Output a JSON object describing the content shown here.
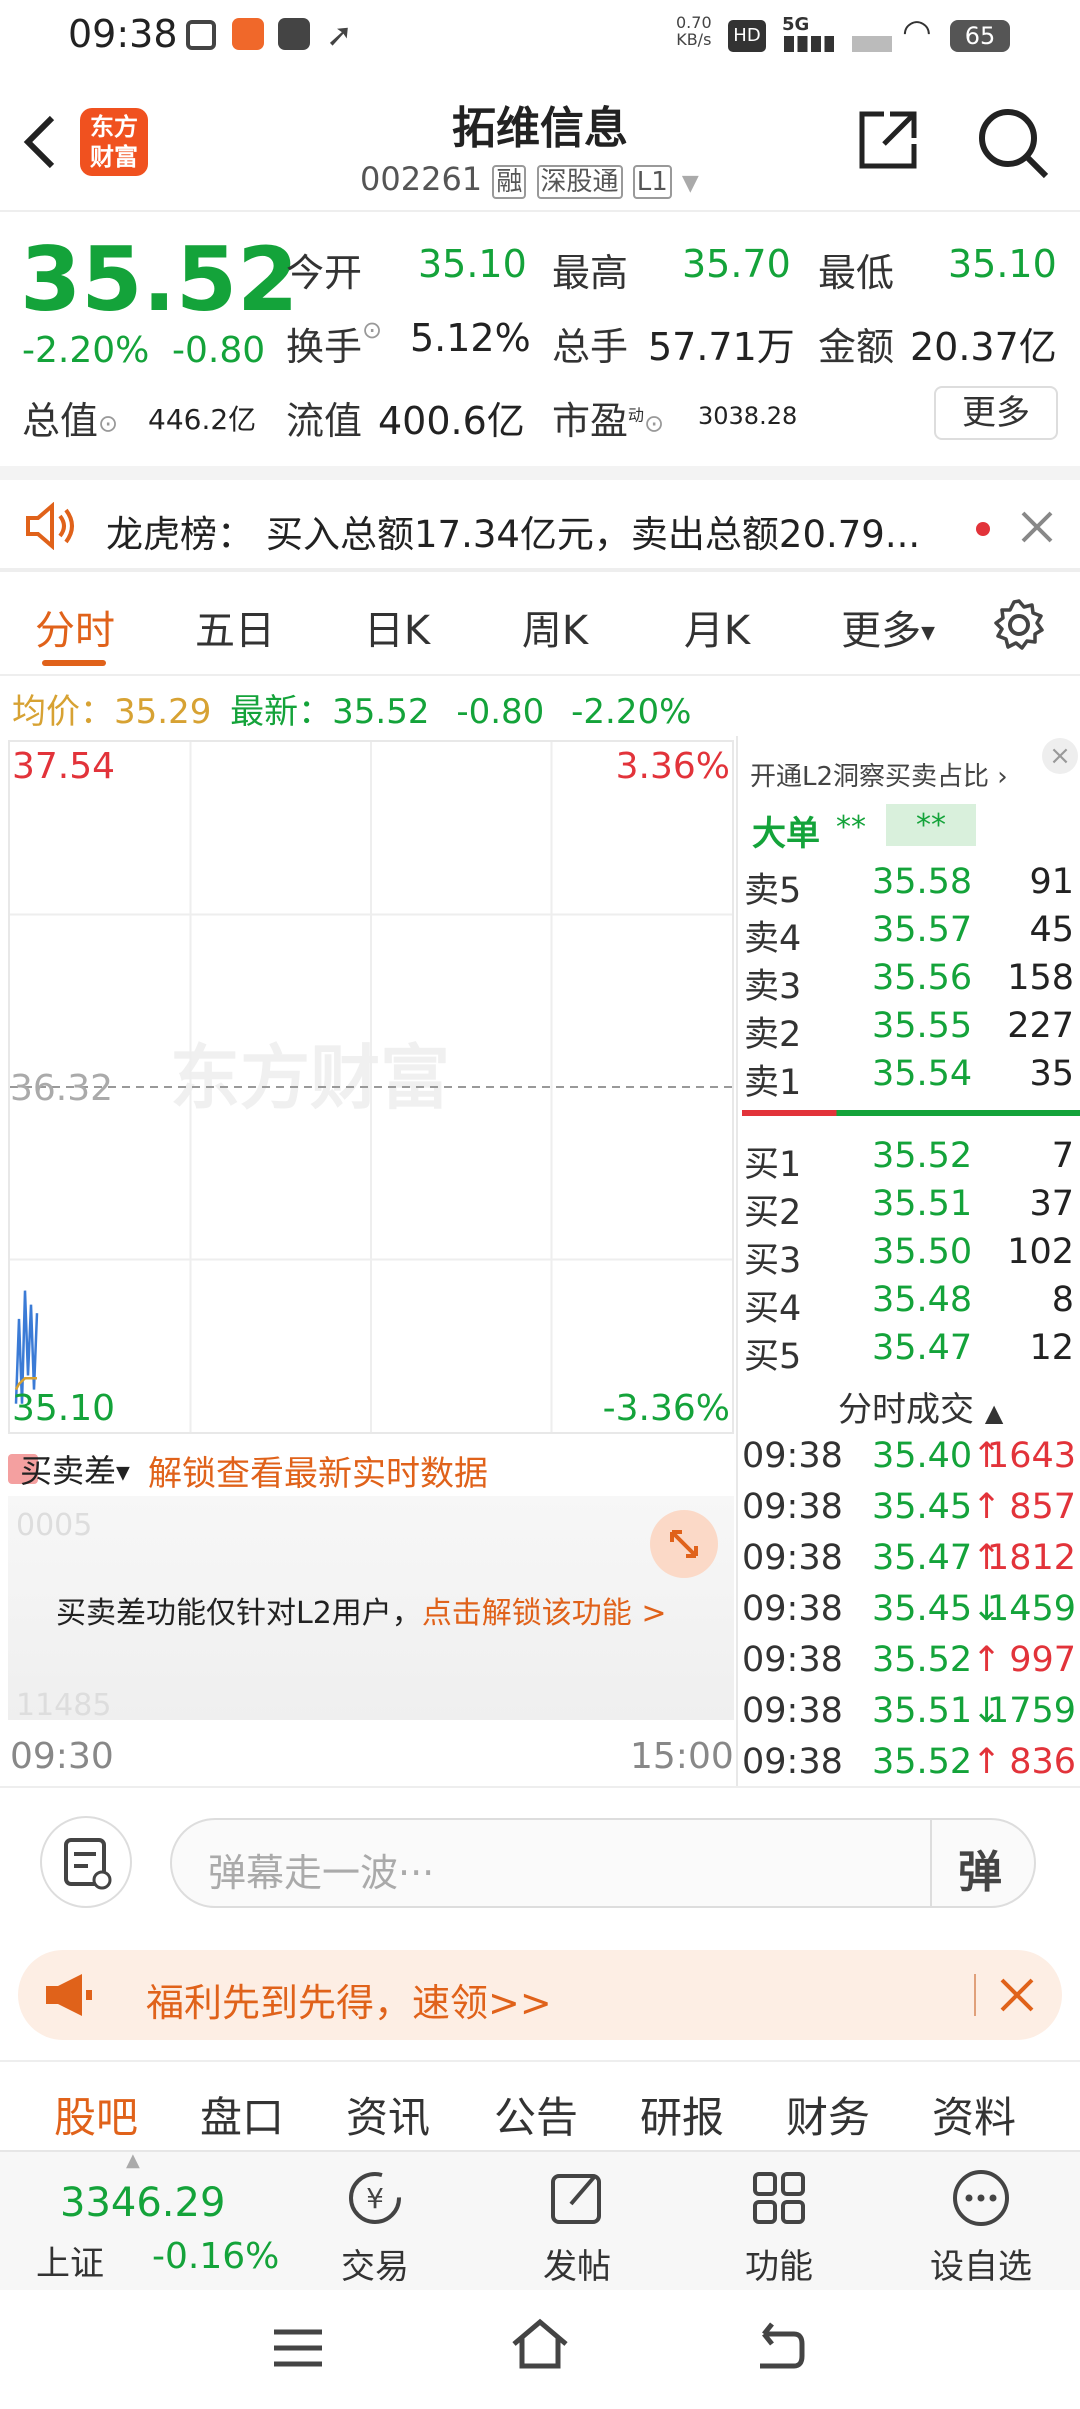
{
  "status_bar": {
    "time": "09:38",
    "net_speed": "0.70",
    "net_unit": "KB/s",
    "network": "5G",
    "battery": "65"
  },
  "header": {
    "logo_text_1": "东方",
    "logo_text_2": "财富",
    "title": "拓维信息",
    "code": "002261",
    "tag_rong": "融",
    "tag_sgt": "深股通",
    "tag_level": "L1"
  },
  "quote": {
    "price": "35.52",
    "change_pct": "-2.20%",
    "change_amt": "-0.80",
    "open_label": "今开",
    "open": "35.10",
    "high_label": "最高",
    "high": "35.70",
    "low_label": "最低",
    "low": "35.10",
    "turnover_label": "换手",
    "turnover": "5.12%",
    "volume_label": "总手",
    "volume": "57.71万",
    "amount_label": "金额",
    "amount": "20.37亿",
    "mktcap_label": "总值",
    "mktcap": "446.2亿",
    "float_label": "流值",
    "float": "400.6亿",
    "pe_label": "市盈",
    "pe_sup": "动",
    "pe": "3038.28",
    "more_button": "更多"
  },
  "notice": {
    "label": "龙虎榜：",
    "text": "买入总额17.34亿元，卖出总额20.79..."
  },
  "chart_tabs": [
    "分时",
    "五日",
    "日K",
    "周K",
    "月K",
    "更多"
  ],
  "avg_line": {
    "avg_label": "均价：",
    "avg": "35.29",
    "latest_label": "最新：",
    "latest": "35.52",
    "change_amt": "-0.80",
    "change_pct": "-2.20%"
  },
  "chart_data": {
    "type": "line",
    "y_top": "37.54",
    "y_mid": "36.32",
    "y_bottom": "35.10",
    "pct_top": "3.36%",
    "pct_bottom": "-3.36%",
    "x_start": "09:30",
    "x_end": "15:00",
    "ylim": [
      35.1,
      37.54
    ],
    "watermark": "东方财富",
    "price_series": [
      35.2,
      35.5,
      35.2,
      35.6,
      35.3,
      35.55,
      35.25,
      35.52
    ],
    "avg_series": [
      35.25,
      35.27,
      35.28,
      35.29,
      35.29,
      35.29,
      35.29,
      35.29
    ]
  },
  "sub_chart": {
    "selector": "买卖差",
    "unlock_link": "解锁查看最新实时数据",
    "y_top": "0005",
    "y_bottom": "11485",
    "lock_text": "买卖差功能仅针对L2用户，",
    "lock_link": "点击解锁该功能 >"
  },
  "order_book": {
    "promo": "开通L2洞察买卖占比",
    "big_order_label": "大单",
    "big_order_val1": "**",
    "big_order_val2": "**",
    "asks": [
      {
        "label": "卖5",
        "price": "35.58",
        "vol": "91"
      },
      {
        "label": "卖4",
        "price": "35.57",
        "vol": "45"
      },
      {
        "label": "卖3",
        "price": "35.56",
        "vol": "158"
      },
      {
        "label": "卖2",
        "price": "35.55",
        "vol": "227"
      },
      {
        "label": "卖1",
        "price": "35.54",
        "vol": "35"
      }
    ],
    "bids": [
      {
        "label": "买1",
        "price": "35.52",
        "vol": "7"
      },
      {
        "label": "买2",
        "price": "35.51",
        "vol": "37"
      },
      {
        "label": "买3",
        "price": "35.50",
        "vol": "102"
      },
      {
        "label": "买4",
        "price": "35.48",
        "vol": "8"
      },
      {
        "label": "买5",
        "price": "35.47",
        "vol": "12"
      }
    ],
    "ticks_header": "分时成交",
    "ticks": [
      {
        "time": "09:38",
        "price": "35.40",
        "dir": "↑",
        "vol": "1643",
        "color": "#e2333a"
      },
      {
        "time": "09:38",
        "price": "35.45",
        "dir": "↑",
        "vol": "857",
        "color": "#e2333a"
      },
      {
        "time": "09:38",
        "price": "35.47",
        "dir": "↑",
        "vol": "1812",
        "color": "#e2333a"
      },
      {
        "time": "09:38",
        "price": "35.45",
        "dir": "↓",
        "vol": "1459",
        "color": "#14a33a"
      },
      {
        "time": "09:38",
        "price": "35.52",
        "dir": "↑",
        "vol": "997",
        "color": "#e2333a"
      },
      {
        "time": "09:38",
        "price": "35.51",
        "dir": "↓",
        "vol": "1759",
        "color": "#14a33a"
      },
      {
        "time": "09:38",
        "price": "35.52",
        "dir": "↑",
        "vol": "836",
        "color": "#e2333a"
      }
    ]
  },
  "comment": {
    "placeholder": "弹幕走一波···",
    "danmu_button": "弹"
  },
  "banner": {
    "text": "福利先到先得，速领>>"
  },
  "bottom_tabs": [
    "股吧",
    "盘口",
    "资讯",
    "公告",
    "研报",
    "财务",
    "资料"
  ],
  "bottom_nav": {
    "index_value": "3346.29",
    "index_name": "上证",
    "index_change": "-0.16%",
    "trade": "交易",
    "post": "发帖",
    "features": "功能",
    "watchlist": "设自选"
  },
  "colors": {
    "up": "#e2333a",
    "down": "#14a33a",
    "accent": "#e0621a",
    "avg": "#d7a233"
  }
}
